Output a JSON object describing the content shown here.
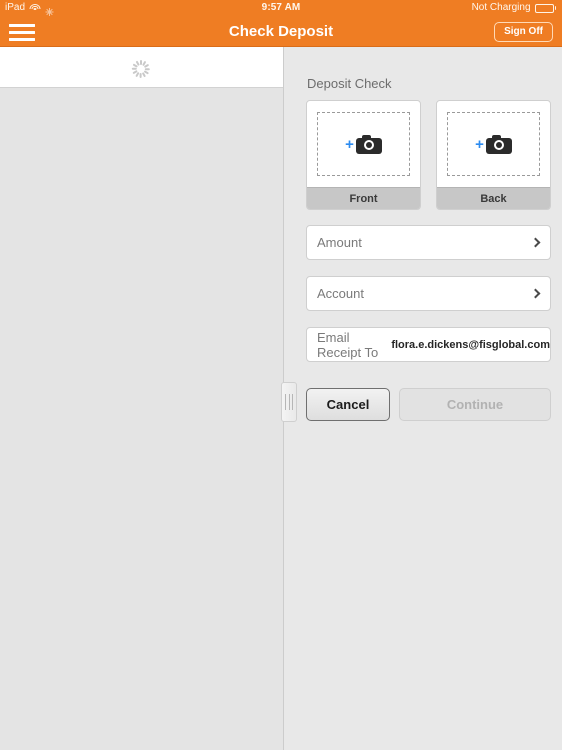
{
  "status_bar": {
    "device": "iPad",
    "wifi_icon": "wifi-icon",
    "sync_icon": "sync-activity-icon",
    "time": "9:57 AM",
    "battery_label": "Not Charging",
    "battery_icon": "battery-icon"
  },
  "navbar": {
    "menu_icon": "hamburger-menu-icon",
    "title": "Check Deposit",
    "sign_off_label": "Sign Off"
  },
  "left_panel": {
    "loading_icon": "loading-spinner-icon"
  },
  "splitter": {
    "handle_icon": "drag-handle-icon"
  },
  "detail": {
    "section_title": "Deposit Check",
    "capture_cards": [
      {
        "label": "Front",
        "camera_icon": "camera-icon",
        "add_icon": "plus-icon"
      },
      {
        "label": "Back",
        "camera_icon": "camera-icon",
        "add_icon": "plus-icon"
      }
    ],
    "fields": [
      {
        "label": "Amount",
        "chevron_icon": "chevron-right-icon"
      },
      {
        "label": "Account",
        "chevron_icon": "chevron-right-icon"
      }
    ],
    "email_row": {
      "label": "Email Receipt To",
      "value": "flora.e.dickens@fisglobal.com"
    },
    "buttons": {
      "cancel": "Cancel",
      "continue": "Continue"
    }
  },
  "colors": {
    "brand_orange": "#ef7d23",
    "accent_blue": "#2d8cf0",
    "panel_gray": "#e8e8e8",
    "footer_gray": "#c7c7c7"
  }
}
